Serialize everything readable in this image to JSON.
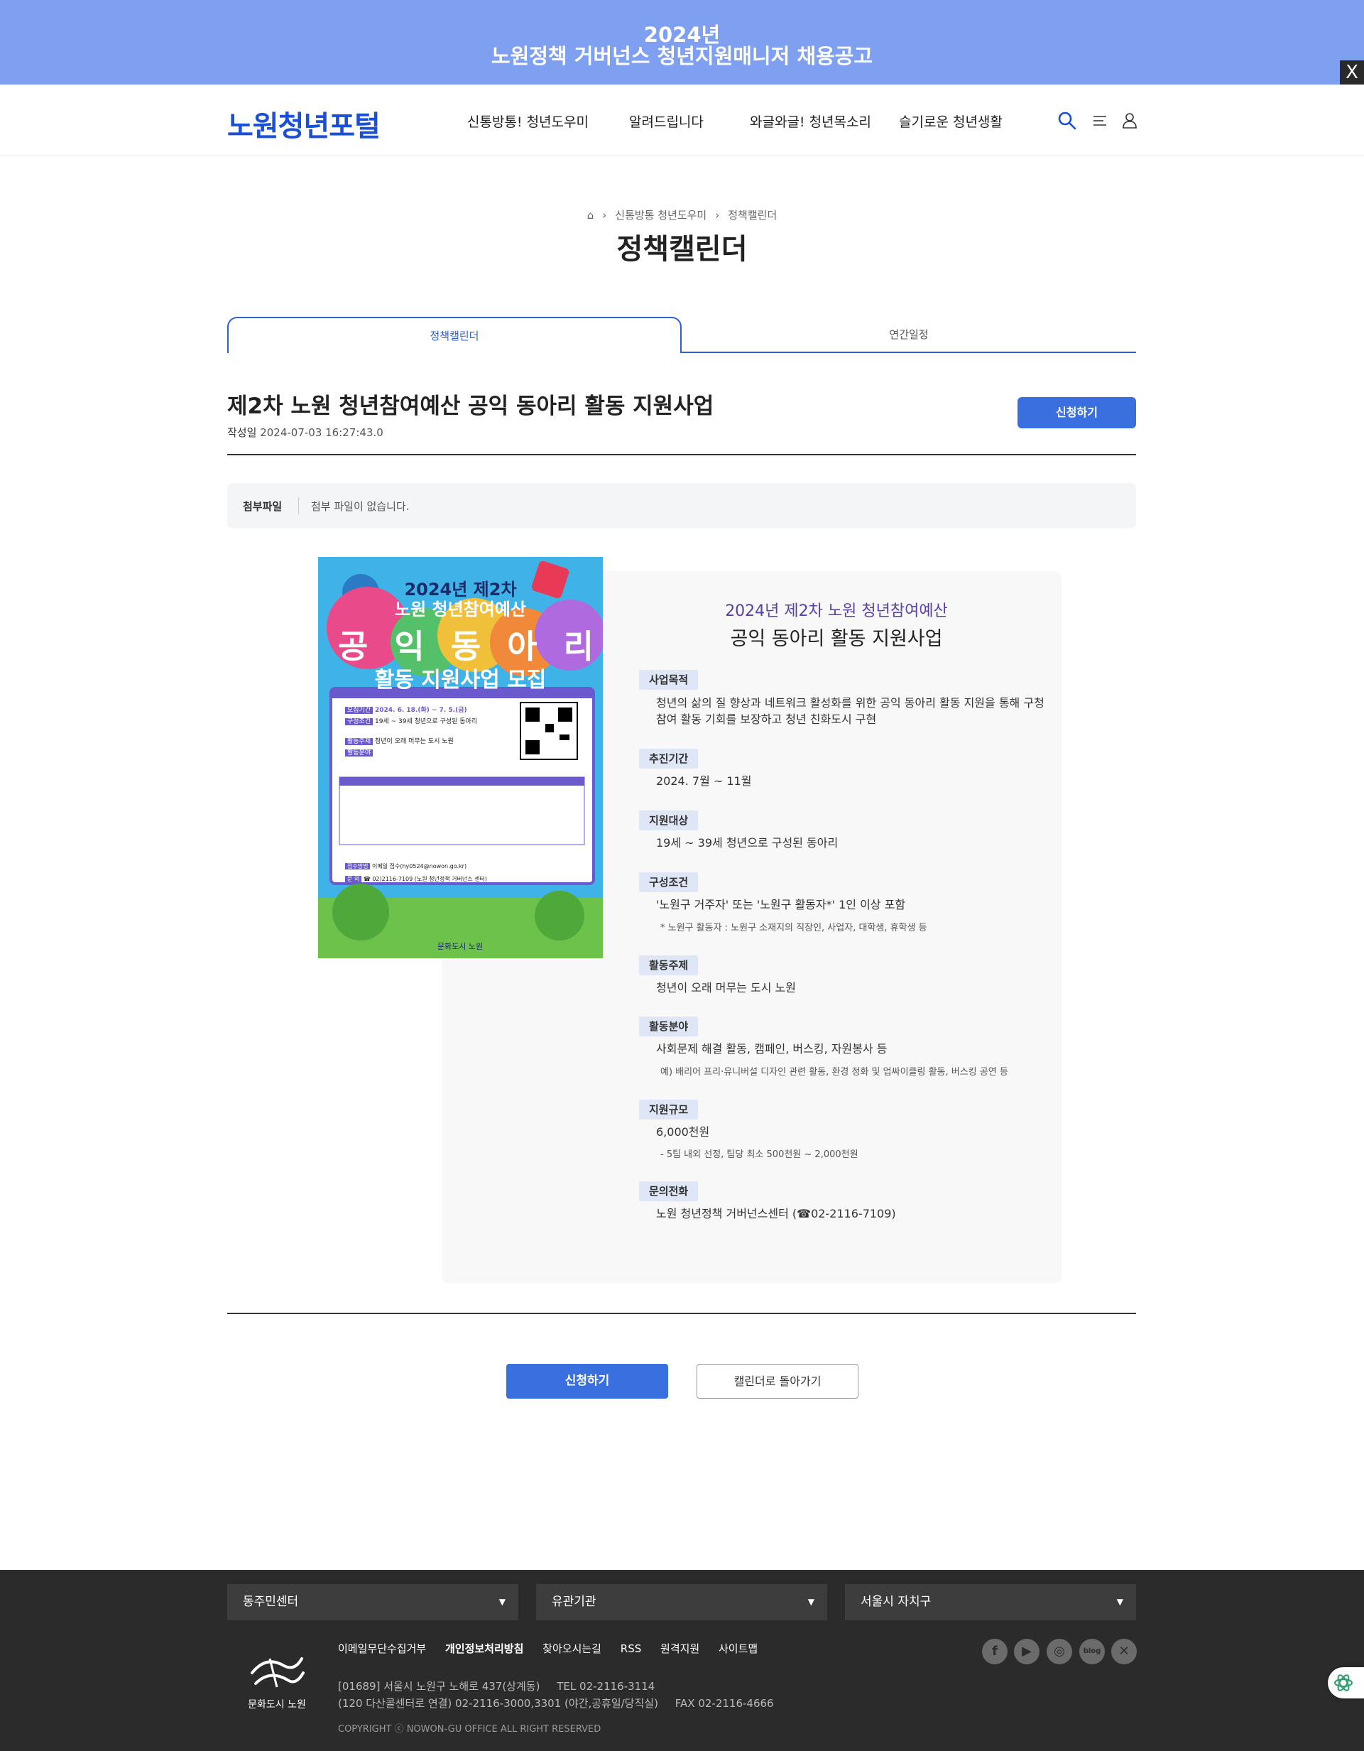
{
  "banner": {
    "line1": "2024년",
    "line2": "노원정책 거버넌스 청년지원매니저 채용공고",
    "close": "X"
  },
  "header": {
    "logo": "노원청년포털",
    "nav": [
      "신통방통! 청년도우미",
      "알려드립니다",
      "와글와글! 청년목소리",
      "슬기로운 청년생활"
    ]
  },
  "hero": {
    "breadcrumb": [
      "신통방통 청년도우미",
      "정책캘린더"
    ],
    "title": "정책캘린더"
  },
  "tabs": {
    "active": "정책캘린더",
    "inactive": "연간일정"
  },
  "post": {
    "title": "제2차 노원 청년참여예산 공익 동아리 활동 지원사업",
    "date_label": "작성일",
    "date_value": "2024-07-03 16:27:43.0",
    "apply_label": "신청하기"
  },
  "attach": {
    "label": "첨부파일",
    "value": "첨부 파일이 없습니다."
  },
  "poster": {
    "line1": "2024년 제2차",
    "line2": "노원 청년참여예산",
    "chars": [
      "공",
      "익",
      "동",
      "아",
      "리"
    ],
    "line4": "활동 지원사업 모집",
    "rows": [
      {
        "k": "모집기간",
        "v": "2024. 6. 18.(화) ~ 7. 5.(금)"
      },
      {
        "k": "구성조건",
        "v": "19세 ~ 39세 청년으로 구성된 동아리"
      },
      {
        "k": "활동주제",
        "v": "청년이 오래 머무는 도시 노원"
      },
      {
        "k": "활동분야",
        "v": ""
      },
      {
        "k": "접수방법",
        "v": "이메일 접수(hy0524@nowon.go.kr)"
      },
      {
        "k": "문 의",
        "v": "☎ 02)2116-7109 (노원 청년정책 거버넌스 센터)"
      }
    ],
    "brand": "문화도시 노원"
  },
  "info": {
    "subtitle": "2024년 제2차 노원 청년참여예산",
    "title": "공익 동아리 활동 지원사업",
    "sections": [
      {
        "label": "사업목적",
        "value": "청년의 삶의 질 향상과 네트워크 활성화를 위한 공익 동아리 활동 지원을 통해 구청",
        "value2": "참여 활동 기회를 보장하고 청년 친화도시 구현",
        "note": ""
      },
      {
        "label": "추진기간",
        "value": "2024. 7월 ~ 11월",
        "value2": "",
        "note": ""
      },
      {
        "label": "지원대상",
        "value": "19세 ~ 39세 청년으로 구성된 동아리",
        "value2": "",
        "note": ""
      },
      {
        "label": "구성조건",
        "value": "'노원구 거주자' 또는 '노원구 활동자*' 1인 이상 포함",
        "value2": "",
        "note": "* 노원구 활동자 : 노원구 소재지의 직장인, 사업자, 대학생, 휴학생 등"
      },
      {
        "label": "활동주제",
        "value": "청년이 오래 머무는 도시 노원",
        "value2": "",
        "note": ""
      },
      {
        "label": "활동분야",
        "value": "사회문제 해결 활동, 캠페인, 버스킹, 자원봉사 등",
        "value2": "",
        "note": "예) 배리어 프리·유니버설 디자인 관련 활동, 환경 정화 및 업싸이클링 활동, 버스킹 공연 등"
      },
      {
        "label": "지원규모",
        "value": "6,000천원",
        "value2": "",
        "note": "- 5팀 내외 선정, 팀당 최소 500천원 ~ 2,000천원"
      },
      {
        "label": "문의전화",
        "value": "노원 청년정책 거버넌스센터 (☎02-2116-7109)",
        "value2": "",
        "note": ""
      }
    ]
  },
  "actions": {
    "apply": "신청하기",
    "back": "캘린더로 돌아가기"
  },
  "footer": {
    "selects": [
      "동주민센터",
      "유관기관",
      "서울시 자치구"
    ],
    "links": [
      "이메일무단수집거부",
      "개인정보처리방침",
      "찾아오시는길",
      "RSS",
      "원격지원",
      "사이트맵"
    ],
    "addr1": "[01689] 서울시 노원구 노해로 437(상계동)     TEL 02-2116-3114",
    "addr2": "(120 다산콜센터로 연결) 02-2116-3000,3301 (야간,공휴일/당직실)     FAX 02-2116-4666",
    "copyright": "COPYRIGHT ⓒ NOWON-GU OFFICE ALL RIGHT RESERVED",
    "brand": "문화도시 노원",
    "social": [
      "facebook-icon",
      "youtube-icon",
      "instagram-icon",
      "blog-icon",
      "x-icon"
    ]
  }
}
